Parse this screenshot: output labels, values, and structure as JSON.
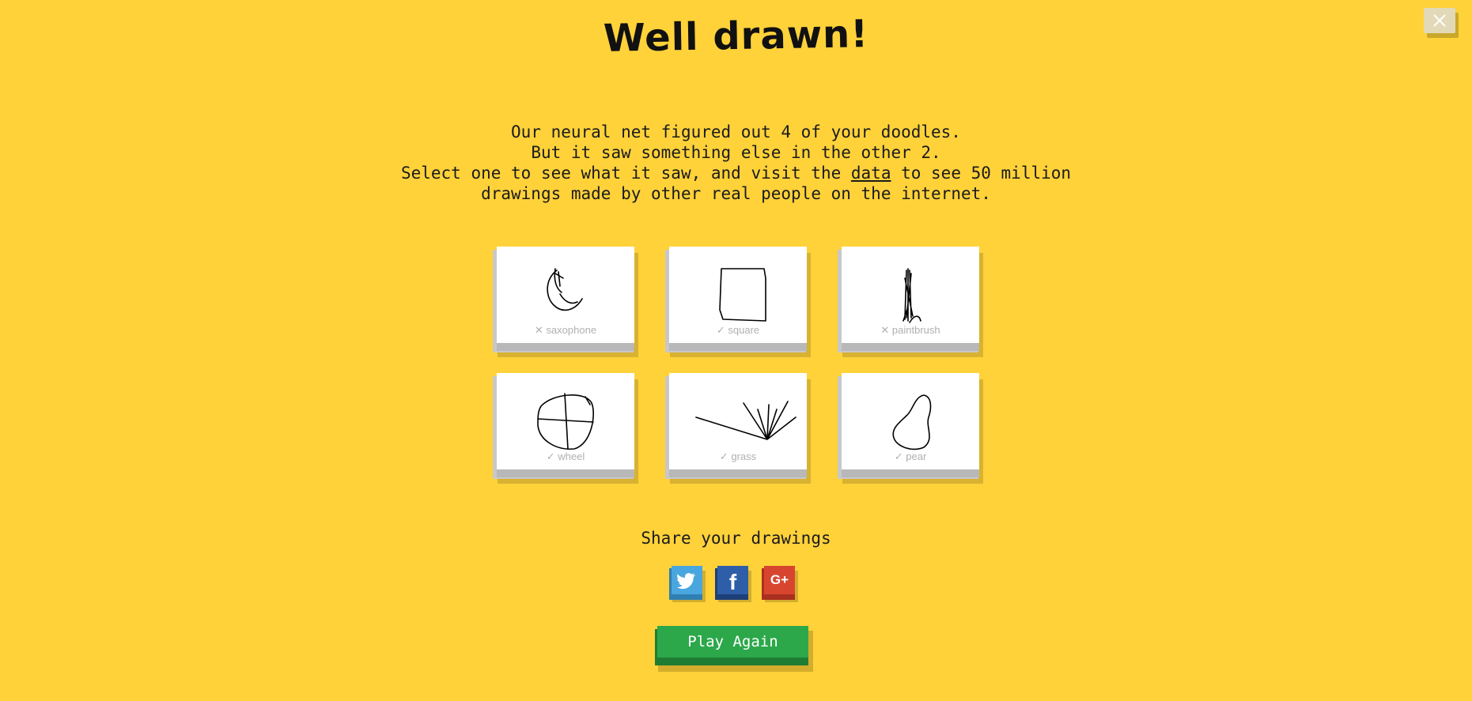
{
  "title": "Well drawn!",
  "message": {
    "line1": "Our neural net figured out 4 of your doodles.",
    "line2": "But it saw something else in the other 2.",
    "line3_before": "Select one to see what it saw, and visit the ",
    "line3_link": "data",
    "line3_after": " to see 50 million",
    "line4": "drawings made by other real people on the internet."
  },
  "drawings": [
    {
      "label": "saxophone",
      "status": "✕",
      "recognized": false
    },
    {
      "label": "square",
      "status": "✓",
      "recognized": true
    },
    {
      "label": "paintbrush",
      "status": "✕",
      "recognized": false
    },
    {
      "label": "wheel",
      "status": "✓",
      "recognized": true
    },
    {
      "label": "grass",
      "status": "✓",
      "recognized": true
    },
    {
      "label": "pear",
      "status": "✓",
      "recognized": true
    }
  ],
  "share": {
    "title": "Share your drawings",
    "twitter_icon": "twitter-icon",
    "facebook_icon": "facebook-icon",
    "google_plus_icon": "google-plus-icon",
    "google_plus_glyph": "G+",
    "facebook_glyph": "f"
  },
  "play_again_label": "Play Again",
  "colors": {
    "background": "#ffd23a",
    "play_button": "#2ca84a",
    "twitter": "#4aa6de",
    "facebook": "#2f5ea8",
    "google_plus": "#d8452f"
  }
}
